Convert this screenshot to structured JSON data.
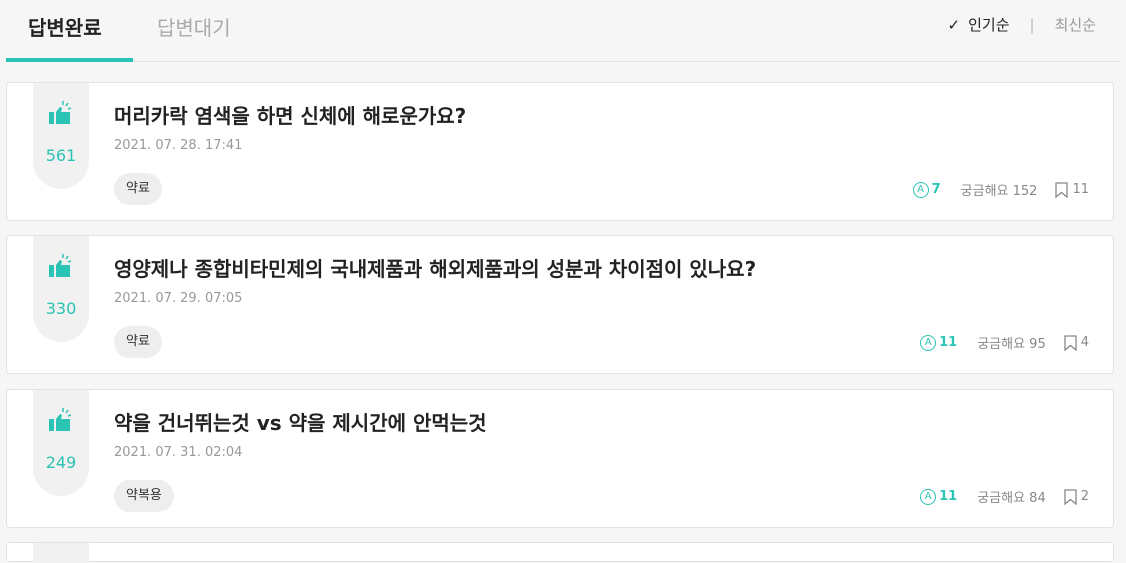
{
  "tabs": {
    "answered": "답변완료",
    "waiting": "답변대기"
  },
  "sort": {
    "popular": "인기순",
    "divider": "|",
    "latest": "최신순"
  },
  "colors": {
    "accent": "#2bc3b4"
  },
  "questions": [
    {
      "votes": "561",
      "title": "머리카락 염색을 하면 신체에 해로운가요?",
      "date": "2021. 07. 28. 17:41",
      "tag": "약료",
      "answers": "7",
      "curious": "궁금해요 152",
      "bookmarks": "11"
    },
    {
      "votes": "330",
      "title": "영양제나 종합비타민제의 국내제품과 해외제품과의 성분과 차이점이 있나요?",
      "date": "2021. 07. 29. 07:05",
      "tag": "약료",
      "answers": "11",
      "curious": "궁금해요 95",
      "bookmarks": "4"
    },
    {
      "votes": "249",
      "title": "약을 건너뛰는것 vs 약을 제시간에 안먹는것",
      "date": "2021. 07. 31. 02:04",
      "tag": "약복용",
      "answers": "11",
      "curious": "궁금해요 84",
      "bookmarks": "2"
    }
  ],
  "icons": {
    "thumb": "thumbs-up-icon",
    "answer": "answer-a-icon",
    "bookmark": "bookmark-icon",
    "check": "check-icon"
  }
}
